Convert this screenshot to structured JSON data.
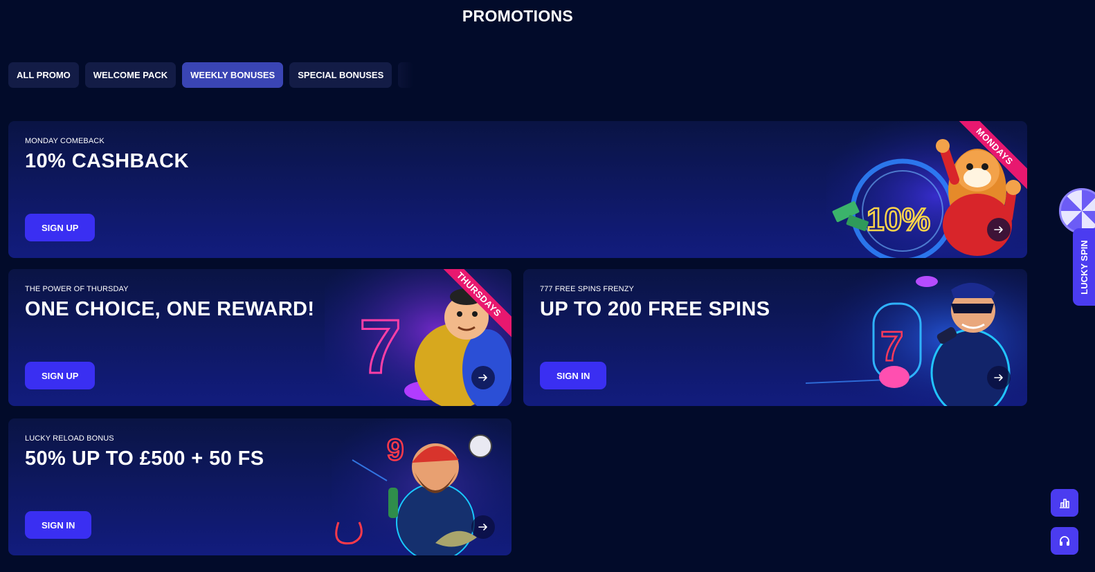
{
  "page": {
    "title": "PROMOTIONS"
  },
  "tabs": [
    {
      "label": "ALL PROMO",
      "active": false
    },
    {
      "label": "WELCOME PACK",
      "active": false
    },
    {
      "label": "WEEKLY BONUSES",
      "active": true
    },
    {
      "label": "SPECIAL BONUSES",
      "active": false
    }
  ],
  "promos": {
    "monday": {
      "subtitle": "MONDAY COMEBACK",
      "headline": "10% CASHBACK",
      "cta": "SIGN UP",
      "ribbon": "MONDAYS",
      "art_text": "10%"
    },
    "thursday": {
      "subtitle": "THE POWER OF THURSDAY",
      "headline": "ONE CHOICE, ONE REWARD!",
      "cta": "SIGN UP",
      "ribbon": "THURSDAYS"
    },
    "freespins": {
      "subtitle": "777 FREE SPINS FRENZY",
      "headline": "UP TO 200 FREE SPINS",
      "cta": "SIGN IN"
    },
    "reload": {
      "subtitle": "LUCKY RELOAD BONUS",
      "headline": "50% UP TO £500 + 50 FS",
      "cta": "SIGN IN"
    }
  },
  "lucky_spin": {
    "label": "LUCKY SPIN"
  },
  "icons": {
    "arrow": "arrow-right-icon",
    "stats": "bar-chart-icon",
    "support": "headset-icon"
  },
  "colors": {
    "background": "#020b2a",
    "cta": "#3a2ff2",
    "tab_active": "#3a45b4",
    "ribbon": "#e8186f",
    "accent_purple": "#4b3cf0"
  }
}
